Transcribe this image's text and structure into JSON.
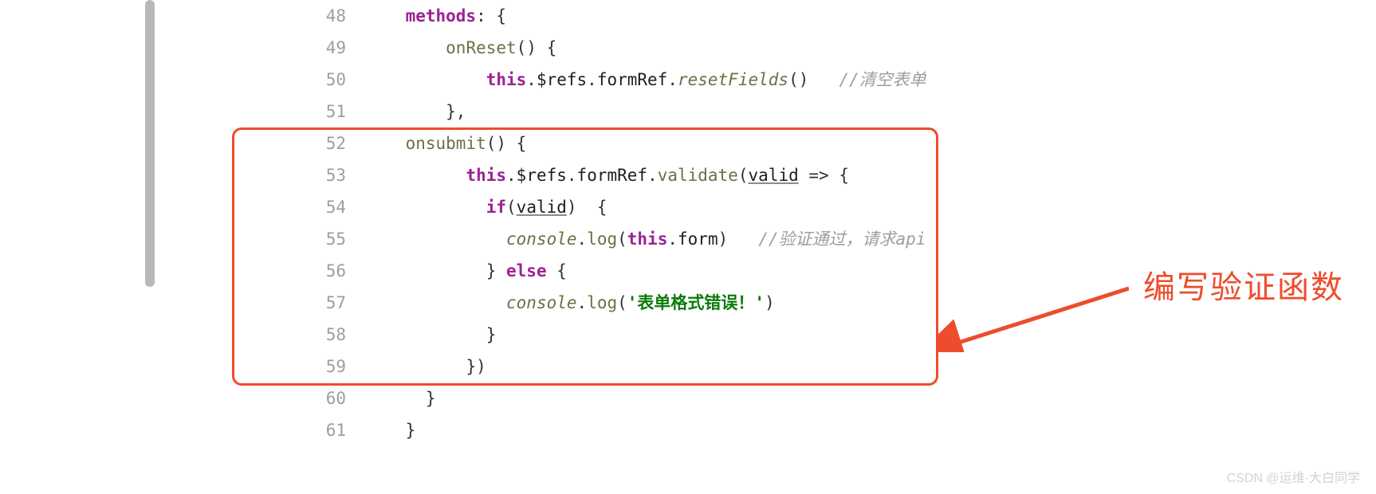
{
  "line_numbers": [
    "48",
    "49",
    "50",
    "51",
    "52",
    "53",
    "54",
    "55",
    "56",
    "57",
    "58",
    "59",
    "60",
    "61"
  ],
  "code": {
    "l48": {
      "methods": "methods",
      "colon_brace": ": {"
    },
    "l49": {
      "fn": "onReset",
      "suffix": "() {"
    },
    "l50": {
      "this": "this",
      "dot1": ".",
      "refs": "$refs",
      "dot2": ".",
      "formRef": "formRef",
      "dot3": ".",
      "reset": "resetFields",
      "parens": "()",
      "comment": "//清空表单"
    },
    "l51": {
      "close": "},"
    },
    "l52": {
      "fn": "onsubmit",
      "suffix": "() {"
    },
    "l53": {
      "this": "this",
      "dot1": ".",
      "refs": "$refs",
      "dot2": ".",
      "formRef": "formRef",
      "dot3": ".",
      "validate": "validate",
      "open": "(",
      "valid": "valid",
      "arrow": " => {"
    },
    "l54": {
      "if": "if",
      "open": "(",
      "valid": "valid",
      "close": ")  {"
    },
    "l55": {
      "console": "console",
      "dot": ".",
      "log": "log",
      "open": "(",
      "this": "this",
      "dot2": ".",
      "form": "form",
      "close": ")",
      "comment": "//验证通过，请求api"
    },
    "l56": {
      "close": "} ",
      "else": "else",
      "brace": " {"
    },
    "l57": {
      "console": "console",
      "dot": ".",
      "log": "log",
      "open": "(",
      "str": "'表单格式错误！'",
      "close": ")"
    },
    "l58": {
      "close": "}"
    },
    "l59": {
      "close": "})"
    },
    "l60": {
      "close": "}"
    },
    "l61": {
      "close": "}"
    }
  },
  "annotation": "编写验证函数",
  "watermark": "CSDN @运维·大白同学"
}
